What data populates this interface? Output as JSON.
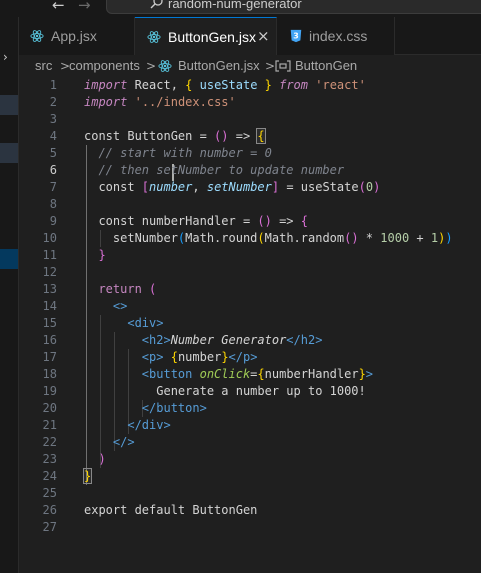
{
  "titlebar": {
    "back_icon": "arrow-left-icon",
    "forward_icon": "arrow-right-icon",
    "search_icon": "search-icon",
    "title": "random-num-generator"
  },
  "tabs": [
    {
      "label": "App.jsx",
      "icon": "react-icon",
      "active": false
    },
    {
      "label": "ButtonGen.jsx",
      "icon": "react-icon",
      "active": true,
      "close": "×"
    },
    {
      "label": "index.css",
      "icon": "css-icon",
      "active": false
    }
  ],
  "breadcrumb": {
    "items": [
      "src",
      "components",
      "ButtonGen.jsx",
      "ButtonGen"
    ],
    "separator": ">"
  },
  "colors": {
    "editor_bg": "#1f1f1f",
    "accent": "#0078d4",
    "react_icon": "#58c4dc",
    "css_icon": "#42a5f5"
  },
  "editor": {
    "current_line": 6,
    "lines": [
      {
        "n": "1",
        "tokens": [
          [
            "kw-i",
            "import"
          ],
          [
            "plain",
            " React, "
          ],
          [
            "br1",
            "{"
          ],
          [
            "var",
            " useState "
          ],
          [
            "br1",
            "}"
          ],
          [
            "plain",
            " "
          ],
          [
            "kw-i",
            "from"
          ],
          [
            "plain",
            " "
          ],
          [
            "str",
            "'react'"
          ]
        ]
      },
      {
        "n": "2",
        "tokens": [
          [
            "kw-i",
            "import"
          ],
          [
            "plain",
            " "
          ],
          [
            "str",
            "'../index.css'"
          ]
        ]
      },
      {
        "n": "3",
        "tokens": []
      },
      {
        "n": "4",
        "tokens": [
          [
            "plain",
            "const ButtonGen = "
          ],
          [
            "br2",
            "()"
          ],
          [
            "plain",
            " => "
          ],
          [
            "br1hl",
            "{"
          ]
        ]
      },
      {
        "n": "5",
        "tokens": [
          [
            "plain",
            "  "
          ],
          [
            "cmt-g",
            "// start with number = 0"
          ]
        ]
      },
      {
        "n": "6",
        "tokens": [
          [
            "plain",
            "  "
          ],
          [
            "cmt-g",
            "// then setNumber to update number"
          ]
        ]
      },
      {
        "n": "7",
        "tokens": [
          [
            "plain",
            "  const "
          ],
          [
            "br2",
            "["
          ],
          [
            "var-i",
            "number"
          ],
          [
            "plain",
            ", "
          ],
          [
            "var-i",
            "setNumber"
          ],
          [
            "br2",
            "]"
          ],
          [
            "plain",
            " = useState"
          ],
          [
            "br2",
            "("
          ],
          [
            "num",
            "0"
          ],
          [
            "br2",
            ")"
          ]
        ]
      },
      {
        "n": "8",
        "tokens": []
      },
      {
        "n": "9",
        "tokens": [
          [
            "plain",
            "  const numberHandler = "
          ],
          [
            "br2",
            "()"
          ],
          [
            "plain",
            " => "
          ],
          [
            "br2",
            "{"
          ]
        ]
      },
      {
        "n": "10",
        "tokens": [
          [
            "plain",
            "    setNumber"
          ],
          [
            "br3",
            "("
          ],
          [
            "plain",
            "Math.round"
          ],
          [
            "br1",
            "("
          ],
          [
            "plain",
            "Math.random"
          ],
          [
            "br2",
            "()"
          ],
          [
            "plain",
            " * "
          ],
          [
            "num",
            "1000"
          ],
          [
            "plain",
            " + "
          ],
          [
            "num",
            "1"
          ],
          [
            "br1",
            ")"
          ],
          [
            "br3",
            ")"
          ]
        ]
      },
      {
        "n": "11",
        "tokens": [
          [
            "plain",
            "  "
          ],
          [
            "br2",
            "}"
          ]
        ]
      },
      {
        "n": "12",
        "tokens": []
      },
      {
        "n": "13",
        "tokens": [
          [
            "plain",
            "  "
          ],
          [
            "kw",
            "return"
          ],
          [
            "plain",
            " "
          ],
          [
            "br2",
            "("
          ]
        ]
      },
      {
        "n": "14",
        "tokens": [
          [
            "plain",
            "    "
          ],
          [
            "tag",
            "<>"
          ]
        ]
      },
      {
        "n": "15",
        "tokens": [
          [
            "plain",
            "      "
          ],
          [
            "tag",
            "<div>"
          ]
        ]
      },
      {
        "n": "16",
        "tokens": [
          [
            "plain",
            "        "
          ],
          [
            "tag",
            "<h2>"
          ],
          [
            "jsx-i",
            "Number Generator"
          ],
          [
            "tag",
            "</h2>"
          ]
        ]
      },
      {
        "n": "17",
        "tokens": [
          [
            "plain",
            "        "
          ],
          [
            "tag",
            "<p>"
          ],
          [
            "plain",
            " "
          ],
          [
            "br1",
            "{"
          ],
          [
            "plain",
            "number"
          ],
          [
            "br1",
            "}"
          ],
          [
            "tag",
            "</p>"
          ]
        ]
      },
      {
        "n": "18",
        "tokens": [
          [
            "plain",
            "        "
          ],
          [
            "tag",
            "<button "
          ],
          [
            "attr-g",
            "onClick"
          ],
          [
            "plain",
            "="
          ],
          [
            "br1",
            "{"
          ],
          [
            "plain",
            "numberHandler"
          ],
          [
            "br1",
            "}"
          ],
          [
            "tag",
            ">"
          ]
        ]
      },
      {
        "n": "19",
        "tokens": [
          [
            "plain",
            "          Generate a number up to 1000!"
          ]
        ]
      },
      {
        "n": "20",
        "tokens": [
          [
            "plain",
            "        "
          ],
          [
            "tag",
            "</button>"
          ]
        ]
      },
      {
        "n": "21",
        "tokens": [
          [
            "plain",
            "      "
          ],
          [
            "tag",
            "</div>"
          ]
        ]
      },
      {
        "n": "22",
        "tokens": [
          [
            "plain",
            "    "
          ],
          [
            "tag",
            "</>"
          ]
        ]
      },
      {
        "n": "23",
        "tokens": [
          [
            "plain",
            "  "
          ],
          [
            "br2",
            ")"
          ]
        ]
      },
      {
        "n": "24",
        "tokens": [
          [
            "br1hl",
            "}"
          ]
        ]
      },
      {
        "n": "25",
        "tokens": []
      },
      {
        "n": "26",
        "tokens": [
          [
            "plain",
            "export default ButtonGen"
          ]
        ]
      },
      {
        "n": "27",
        "tokens": []
      }
    ]
  }
}
